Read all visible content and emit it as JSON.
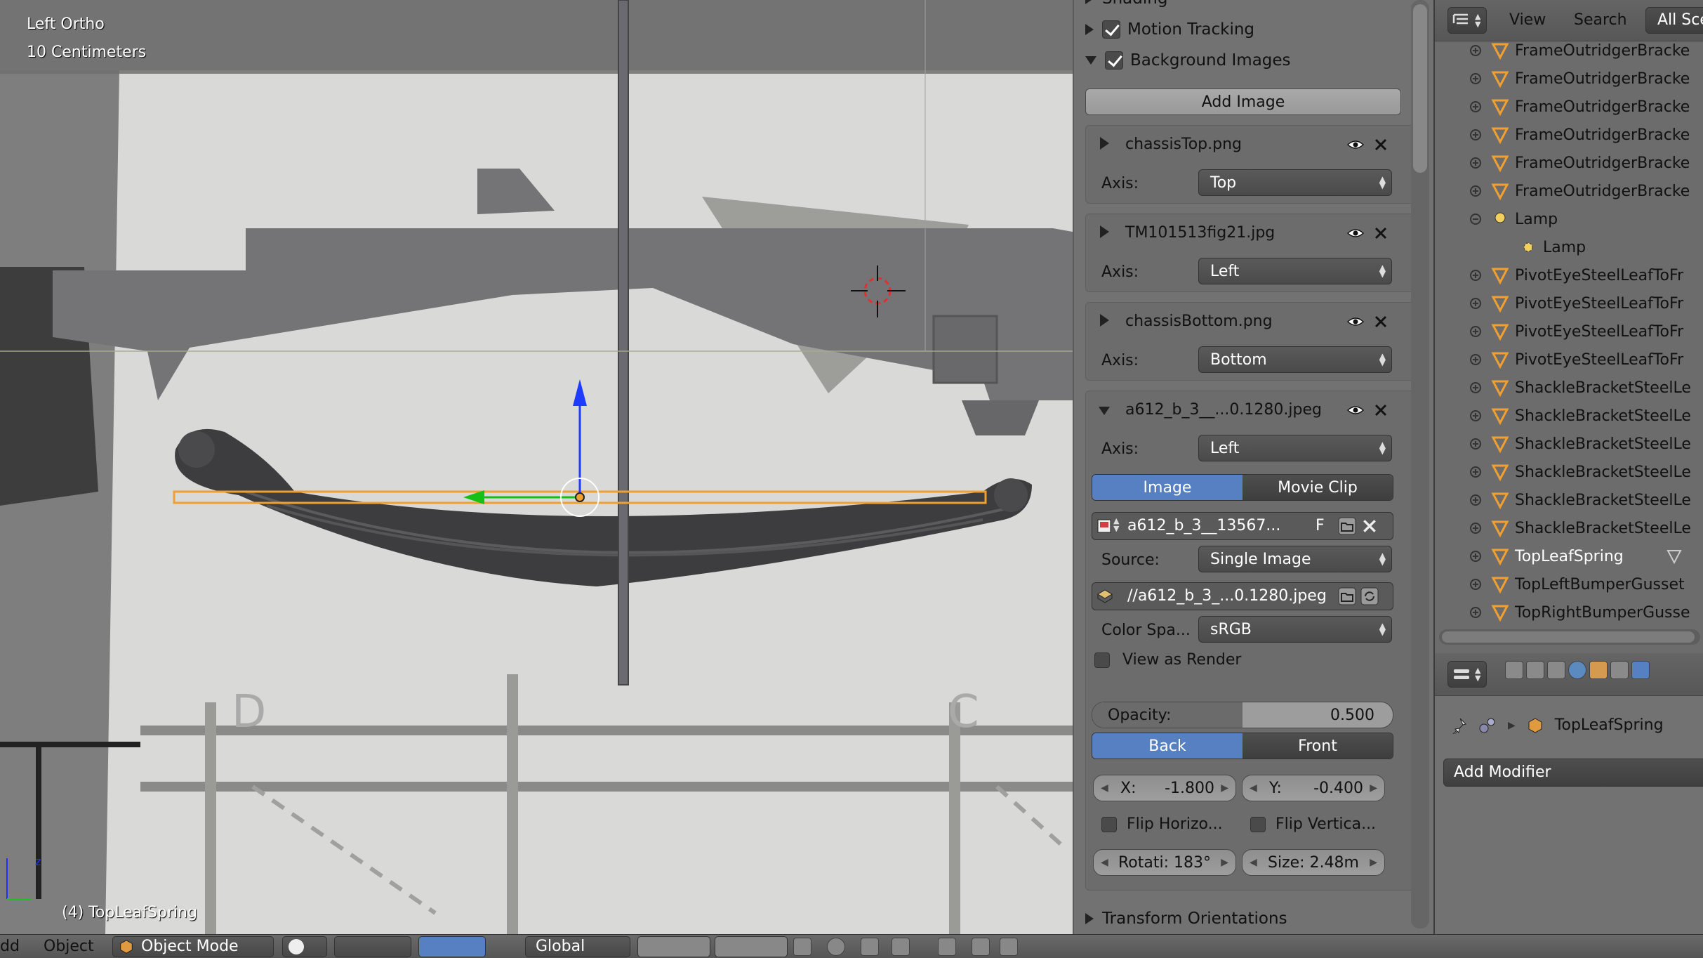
{
  "viewport": {
    "view_name": "Left Ortho",
    "scale": "10 Centimeters",
    "object_label": "(4) TopLeafSpring",
    "colors": {
      "selection": "#f0a030",
      "z_axis": "#1e3cff",
      "y_axis": "#16c016"
    }
  },
  "properties": {
    "shading_header": "Shading",
    "motion_tracking": "Motion Tracking",
    "background_images": "Background Images",
    "add_image": "Add Image",
    "axis_label": "Axis:",
    "images": [
      {
        "name": "chassisTop.png",
        "axis": "Top"
      },
      {
        "name": "TM101513fig21.jpg",
        "axis": "Left"
      },
      {
        "name": "chassisBottom.png",
        "axis": "Bottom"
      },
      {
        "name": "a612_b_3__...0.1280.jpeg",
        "axis": "Left"
      }
    ],
    "expanded": {
      "tab_image": "Image",
      "tab_movie_clip": "Movie Clip",
      "datablock": "a612_b_3__13567...",
      "fake_user": "F",
      "source_label": "Source:",
      "source_value": "Single Image",
      "filepath": "//a612_b_3_...0.1280.jpeg",
      "colorspace_label": "Color Spa...",
      "colorspace_value": "sRGB",
      "view_as_render": "View as Render",
      "opacity_label": "Opacity:",
      "opacity_value": "0.500",
      "opacity_fraction": 0.5,
      "back": "Back",
      "front": "Front",
      "x_label": "X:",
      "x_value": "-1.800",
      "y_label": "Y:",
      "y_value": "-0.400",
      "flip_h": "Flip Horizo...",
      "flip_v": "Flip Vertica...",
      "rotation": "Rotati: 183°",
      "size": "Size: 2.48m"
    },
    "transform_orientations": "Transform Orientations"
  },
  "outliner": {
    "view": "View",
    "search": "Search",
    "scenes": "All Sce",
    "rows": [
      {
        "name": "FrameOutridgerBracke",
        "type": "mesh",
        "level": 0
      },
      {
        "name": "FrameOutridgerBracke",
        "type": "mesh",
        "level": 0
      },
      {
        "name": "FrameOutridgerBracke",
        "type": "mesh",
        "level": 0
      },
      {
        "name": "FrameOutridgerBracke",
        "type": "mesh",
        "level": 0
      },
      {
        "name": "FrameOutridgerBracke",
        "type": "mesh",
        "level": 0
      },
      {
        "name": "FrameOutridgerBracke",
        "type": "mesh",
        "level": 0
      },
      {
        "name": "Lamp",
        "type": "lamp",
        "level": 0
      },
      {
        "name": "Lamp",
        "type": "lampdata",
        "level": 1
      },
      {
        "name": "PivotEyeSteelLeafToFr",
        "type": "mesh",
        "level": 0
      },
      {
        "name": "PivotEyeSteelLeafToFr",
        "type": "mesh",
        "level": 0
      },
      {
        "name": "PivotEyeSteelLeafToFr",
        "type": "mesh",
        "level": 0
      },
      {
        "name": "PivotEyeSteelLeafToFr",
        "type": "mesh",
        "level": 0
      },
      {
        "name": "ShackleBracketSteelLe",
        "type": "mesh",
        "level": 0
      },
      {
        "name": "ShackleBracketSteelLe",
        "type": "mesh",
        "level": 0
      },
      {
        "name": "ShackleBracketSteelLe",
        "type": "mesh",
        "level": 0
      },
      {
        "name": "ShackleBracketSteelLe",
        "type": "mesh",
        "level": 0
      },
      {
        "name": "ShackleBracketSteelLe",
        "type": "mesh",
        "level": 0
      },
      {
        "name": "ShackleBracketSteelLe",
        "type": "mesh",
        "level": 0
      },
      {
        "name": "TopLeafSpring",
        "type": "mesh",
        "level": 0,
        "selected": true
      },
      {
        "name": "TopLeftBumperGusset",
        "type": "mesh",
        "level": 0
      },
      {
        "name": "TopRightBumperGusse",
        "type": "mesh",
        "level": 0
      }
    ]
  },
  "modifier_panel": {
    "object": "TopLeafSpring",
    "add_modifier": "Add Modifier"
  },
  "bottom_bar": {
    "add": "dd",
    "object": "Object",
    "mode": "Object Mode",
    "orientation": "Global"
  }
}
